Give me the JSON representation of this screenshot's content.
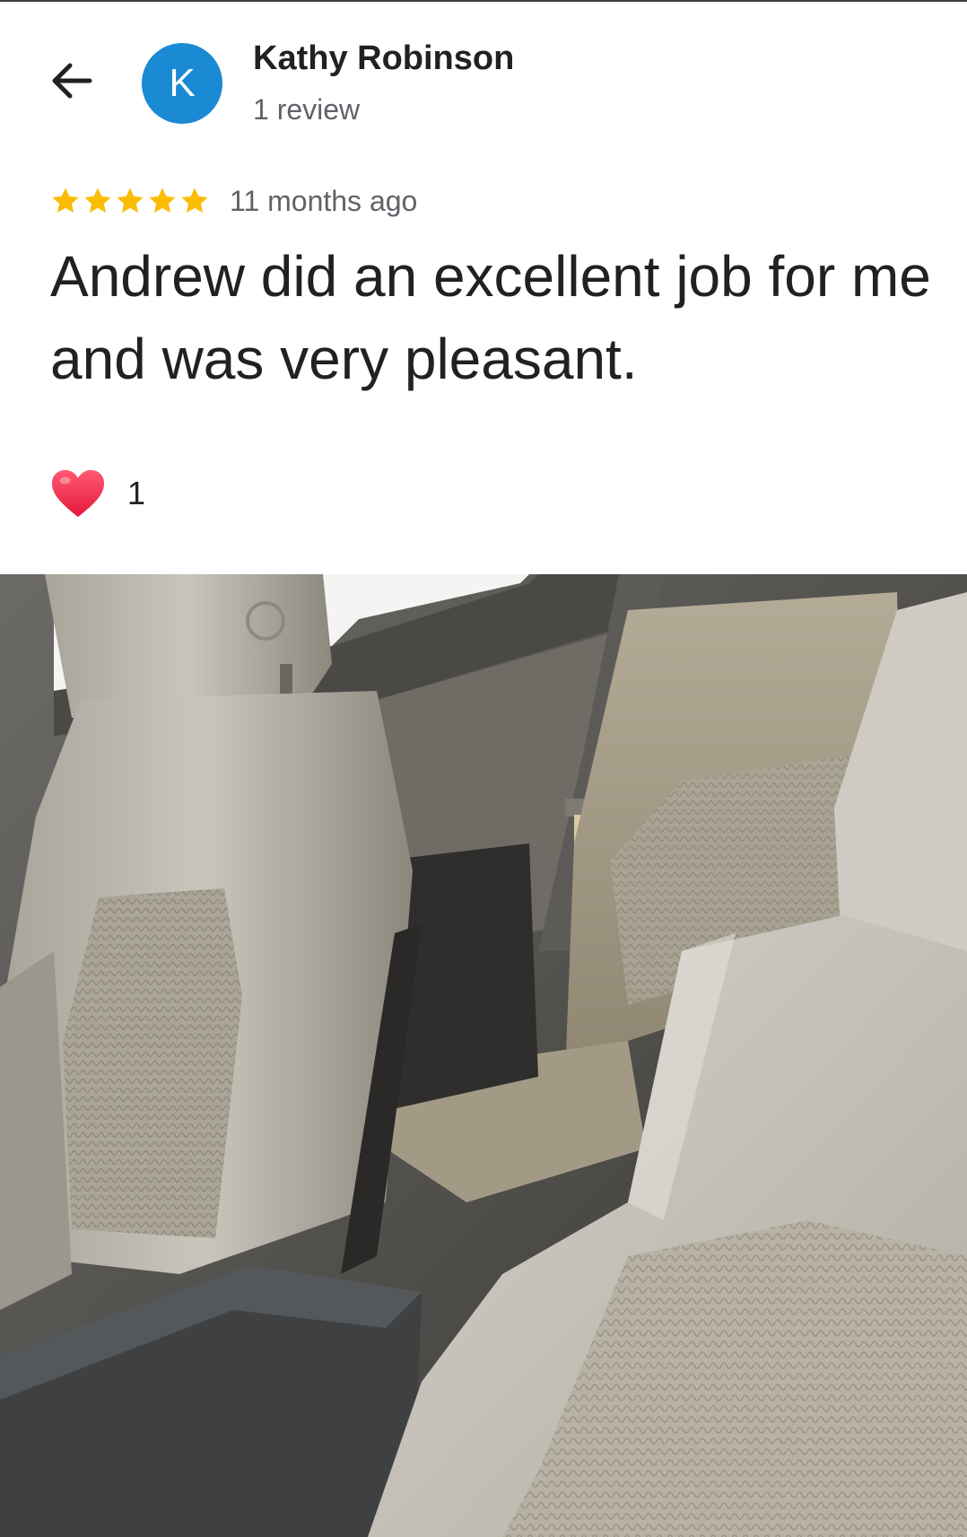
{
  "icons": {
    "back": "arrow-left-icon",
    "star": "star-icon",
    "reaction": "heart-icon"
  },
  "colors": {
    "avatar_bg": "#1a8ad4",
    "star": "#fbbc04",
    "heart": "#f0304a",
    "secondary_text": "#5f6368"
  },
  "reviewer": {
    "avatar_initial": "K",
    "name": "Kathy Robinson",
    "review_count": "1 review"
  },
  "review": {
    "rating": 5,
    "rating_max": 5,
    "time": "11 months ago",
    "text": "Andrew did an excellent job for me and was very pleasant.",
    "reaction_count": "1"
  }
}
